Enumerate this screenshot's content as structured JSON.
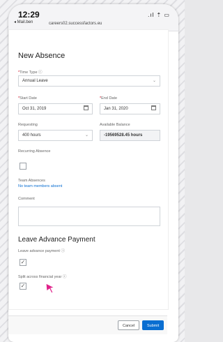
{
  "status_bar": {
    "time": "12:29",
    "back": "◂ Mail.ben",
    "url": "careers02.successfactors.eu",
    "signal": ".ıl ⇡ ▭"
  },
  "form": {
    "title": "New Absence",
    "time_type": {
      "label": "Time Type ⓘ",
      "value": "Annual Leave"
    },
    "start_date": {
      "label": "Start Date",
      "value": "Oct 31, 2019"
    },
    "end_date": {
      "label": "End Date",
      "value": "Jan 31, 2020"
    },
    "requesting": {
      "label": "Requesting",
      "value": "400 hours"
    },
    "available_balance": {
      "label": "Available Balance",
      "value": "-19569528.45 hours"
    },
    "recurring_absence": {
      "label": "Recurring Absence"
    },
    "team_absences": {
      "label": "Team Absences",
      "link": "No team members absent"
    },
    "comment": {
      "label": "Comment"
    },
    "advance_payment": {
      "title": "Leave Advance Payment",
      "leave_advance_label": "Leave advance payment ⓘ",
      "leave_advance_checked": "✓",
      "split_label": "Split across financial year ⓘ",
      "split_checked": "✓"
    }
  },
  "footer": {
    "cancel": "Cancel",
    "submit": "Submit"
  },
  "required_marker": "*"
}
